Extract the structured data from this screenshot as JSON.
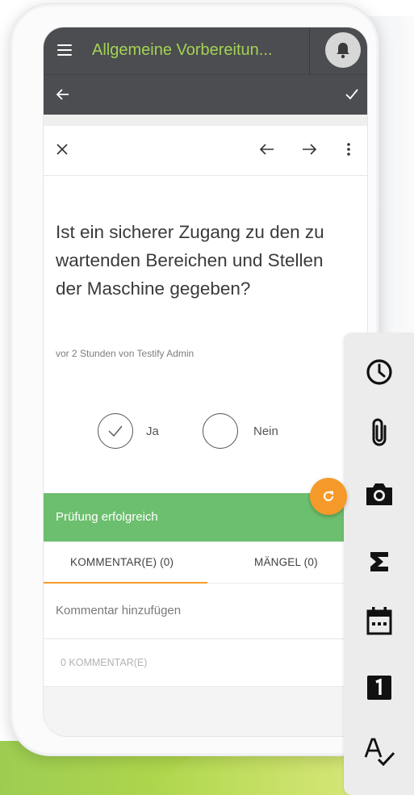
{
  "app": {
    "title": "Allgemeine Vorbereitun...",
    "title_color": "#a3d254",
    "appbar_color": "#4b4d50"
  },
  "icons": {
    "menu": "hamburger-icon",
    "notifications": "bell-icon",
    "back": "arrow-left-icon",
    "confirm": "check-icon",
    "close": "close-icon",
    "previous": "arrow-left-icon",
    "next": "arrow-right-icon",
    "more": "more-vert-icon",
    "refresh": "refresh-icon"
  },
  "question": {
    "text": "Ist ein sicherer Zugang zu den zu wartenden Bereichen und Stellen der Maschine gegeben?",
    "meta": "vor 2 Stunden von Testify Admin"
  },
  "answers": {
    "yes_label": "Ja",
    "no_label": "Nein",
    "selected": "Ja"
  },
  "status": {
    "text": "Prüfung erfolgreich",
    "color": "#6cbf6e"
  },
  "tabs": [
    {
      "label": "KOMMENTAR(E) (0)",
      "active": true
    },
    {
      "label": "MÄNGEL (0)",
      "active": false
    }
  ],
  "comments": {
    "placeholder": "Kommentar hinzufügen",
    "count_label": "0 KOMMENTAR(E)"
  },
  "accent_color": "#f59a2a",
  "palette": {
    "items": [
      "clock-icon",
      "paperclip-icon",
      "camera-icon",
      "sigma-icon",
      "calendar-icon",
      "number-one-icon",
      "spellcheck-icon"
    ]
  }
}
